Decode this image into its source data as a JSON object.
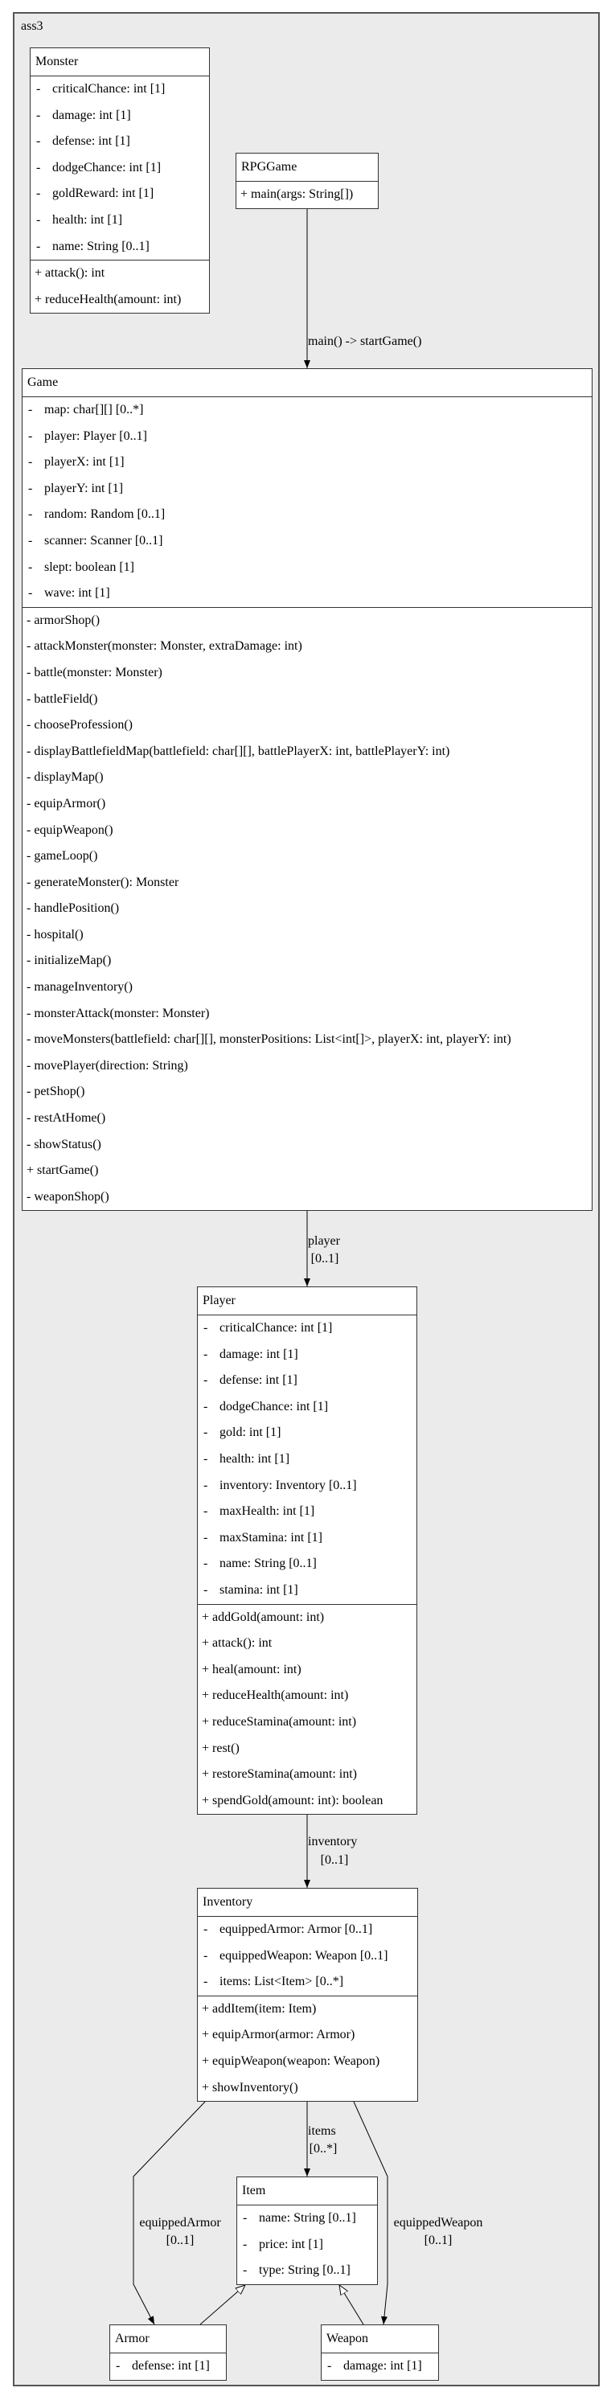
{
  "package": "ass3",
  "classes": {
    "monster": {
      "name": "Monster",
      "attributes": [
        {
          "vis": "-",
          "text": "criticalChance: int [1]"
        },
        {
          "vis": "-",
          "text": "damage: int [1]"
        },
        {
          "vis": "-",
          "text": "defense: int [1]"
        },
        {
          "vis": "-",
          "text": "dodgeChance: int [1]"
        },
        {
          "vis": "-",
          "text": "goldReward: int [1]"
        },
        {
          "vis": "-",
          "text": "health: int [1]"
        },
        {
          "vis": "-",
          "text": "name: String [0..1]"
        }
      ],
      "methods": [
        "+ attack(): int",
        "+ reduceHealth(amount: int)"
      ]
    },
    "rpggame": {
      "name": "RPGGame",
      "attributes": [],
      "methods": [
        "+ main(args: String[])"
      ]
    },
    "game": {
      "name": "Game",
      "attributes": [
        {
          "vis": "-",
          "text": "map: char[][] [0..*]"
        },
        {
          "vis": "-",
          "text": "player: Player [0..1]"
        },
        {
          "vis": "-",
          "text": "playerX: int [1]"
        },
        {
          "vis": "-",
          "text": "playerY: int [1]"
        },
        {
          "vis": "-",
          "text": "random: Random [0..1]"
        },
        {
          "vis": "-",
          "text": "scanner: Scanner [0..1]"
        },
        {
          "vis": "-",
          "text": "slept: boolean [1]"
        },
        {
          "vis": "-",
          "text": "wave: int [1]"
        }
      ],
      "methods": [
        "- armorShop()",
        "- attackMonster(monster: Monster, extraDamage: int)",
        "- battle(monster: Monster)",
        "- battleField()",
        "- chooseProfession()",
        "- displayBattlefieldMap(battlefield: char[][], battlePlayerX: int, battlePlayerY: int)",
        "- displayMap()",
        "- equipArmor()",
        "- equipWeapon()",
        "- gameLoop()",
        "- generateMonster(): Monster",
        "- handlePosition()",
        "- hospital()",
        "- initializeMap()",
        "- manageInventory()",
        "- monsterAttack(monster: Monster)",
        "- moveMonsters(battlefield: char[][], monsterPositions: List<int[]>, playerX: int, playerY: int)",
        "- movePlayer(direction: String)",
        "- petShop()",
        "- restAtHome()",
        "- showStatus()",
        "+ startGame()",
        "- weaponShop()"
      ]
    },
    "player": {
      "name": "Player",
      "attributes": [
        {
          "vis": "-",
          "text": "criticalChance: int [1]"
        },
        {
          "vis": "-",
          "text": "damage: int [1]"
        },
        {
          "vis": "-",
          "text": "defense: int [1]"
        },
        {
          "vis": "-",
          "text": "dodgeChance: int [1]"
        },
        {
          "vis": "-",
          "text": "gold: int [1]"
        },
        {
          "vis": "-",
          "text": "health: int [1]"
        },
        {
          "vis": "-",
          "text": "inventory: Inventory [0..1]"
        },
        {
          "vis": "-",
          "text": "maxHealth: int [1]"
        },
        {
          "vis": "-",
          "text": "maxStamina: int [1]"
        },
        {
          "vis": "-",
          "text": "name: String [0..1]"
        },
        {
          "vis": "-",
          "text": "stamina: int [1]"
        }
      ],
      "methods": [
        "+ addGold(amount: int)",
        "+ attack(): int",
        "+ heal(amount: int)",
        "+ reduceHealth(amount: int)",
        "+ reduceStamina(amount: int)",
        "+ rest()",
        "+ restoreStamina(amount: int)",
        "+ spendGold(amount: int): boolean"
      ]
    },
    "inventory": {
      "name": "Inventory",
      "attributes": [
        {
          "vis": "-",
          "text": "equippedArmor: Armor [0..1]"
        },
        {
          "vis": "-",
          "text": "equippedWeapon: Weapon [0..1]"
        },
        {
          "vis": "-",
          "text": "items: List<Item> [0..*]"
        }
      ],
      "methods": [
        "+ addItem(item: Item)",
        "+ equipArmor(armor: Armor)",
        "+ equipWeapon(weapon: Weapon)",
        "+ showInventory()"
      ]
    },
    "item": {
      "name": "Item",
      "attributes": [
        {
          "vis": "-",
          "text": "name: String [0..1]"
        },
        {
          "vis": "-",
          "text": "price: int [1]"
        },
        {
          "vis": "-",
          "text": "type: String [0..1]"
        }
      ],
      "methods": []
    },
    "armor": {
      "name": "Armor",
      "attributes": [
        {
          "vis": "-",
          "text": "defense: int [1]"
        }
      ],
      "methods": []
    },
    "weapon": {
      "name": "Weapon",
      "attributes": [
        {
          "vis": "-",
          "text": "damage: int [1]"
        }
      ],
      "methods": []
    }
  },
  "edges": {
    "rpggame_game": {
      "label": [
        "main() -> startGame()"
      ]
    },
    "game_player": {
      "label": [
        "player",
        "[0..1]"
      ]
    },
    "player_inventory": {
      "label": [
        "inventory",
        "[0..1]"
      ]
    },
    "inventory_item": {
      "label": [
        "items",
        "[0..*]"
      ]
    },
    "inventory_armor": {
      "label": [
        "equippedArmor",
        "[0..1]"
      ]
    },
    "inventory_weapon": {
      "label": [
        "equippedWeapon",
        "[0..1]"
      ]
    }
  },
  "colors": {
    "background": "#ebebeb",
    "frame": "#555555",
    "box_border": "#333333"
  }
}
